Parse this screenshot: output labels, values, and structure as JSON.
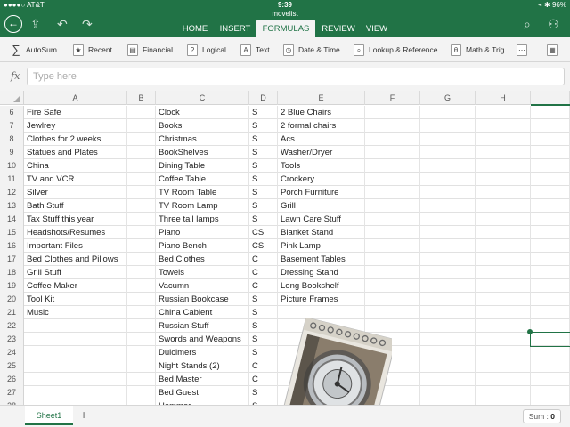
{
  "status_bar": {
    "left": "●●●●○ AT&T",
    "time": "9:39",
    "right": "⌁ ✱ 96%"
  },
  "document_title": "movelist",
  "ribbon_tabs": [
    {
      "label": "HOME",
      "active": false
    },
    {
      "label": "INSERT",
      "active": false
    },
    {
      "label": "FORMULAS",
      "active": true
    },
    {
      "label": "REVIEW",
      "active": false
    },
    {
      "label": "VIEW",
      "active": false
    }
  ],
  "toolbar": {
    "items": [
      {
        "label": "AutoSum",
        "icon": "sigma-icon"
      },
      {
        "label": "Recent",
        "icon": "star-icon"
      },
      {
        "label": "Financial",
        "icon": "financial-icon"
      },
      {
        "label": "Logical",
        "icon": "logical-icon"
      },
      {
        "label": "Text",
        "icon": "text-icon"
      },
      {
        "label": "Date & Time",
        "icon": "clock-icon"
      },
      {
        "label": "Lookup & Reference",
        "icon": "lookup-icon"
      },
      {
        "label": "Math & Trig",
        "icon": "math-icon"
      }
    ]
  },
  "formula_bar": {
    "fx_label": "fx",
    "placeholder": "Type here"
  },
  "columns": [
    "A",
    "B",
    "C",
    "D",
    "E",
    "F",
    "G",
    "H",
    "I"
  ],
  "rows": [
    {
      "n": "6",
      "A": "Fire Safe",
      "C": "Clock",
      "D": "S",
      "E": "2 Blue Chairs"
    },
    {
      "n": "7",
      "A": "Jewlrey",
      "C": "Books",
      "D": "S",
      "E": "2 formal chairs"
    },
    {
      "n": "8",
      "A": "Clothes for 2 weeks",
      "C": "Christmas",
      "D": "S",
      "E": "Acs"
    },
    {
      "n": "9",
      "A": "Statues and Plates",
      "C": "BookShelves",
      "D": "S",
      "E": "Washer/Dryer"
    },
    {
      "n": "10",
      "A": "China",
      "C": "Dining Table",
      "D": "S",
      "E": "Tools"
    },
    {
      "n": "11",
      "A": "TV and VCR",
      "C": "Coffee Table",
      "D": "S",
      "E": "Crockery"
    },
    {
      "n": "12",
      "A": "Silver",
      "C": "TV Room Table",
      "D": "S",
      "E": "Porch Furniture"
    },
    {
      "n": "13",
      "A": "Bath Stuff",
      "C": "TV Room Lamp",
      "D": "S",
      "E": "Grill"
    },
    {
      "n": "14",
      "A": "Tax Stuff this year",
      "C": "Three tall lamps",
      "D": "S",
      "E": "Lawn Care Stuff"
    },
    {
      "n": "15",
      "A": "Headshots/Resumes",
      "C": "Piano",
      "D": "CS",
      "E": "Blanket Stand"
    },
    {
      "n": "16",
      "A": "Important Files",
      "C": "Piano Bench",
      "D": "CS",
      "E": "Pink Lamp"
    },
    {
      "n": "17",
      "A": "Bed Clothes and Pillows",
      "C": "Bed Clothes",
      "D": "C",
      "E": "Basement Tables"
    },
    {
      "n": "18",
      "A": "Grill Stuff",
      "C": "Towels",
      "D": "C",
      "E": "Dressing Stand"
    },
    {
      "n": "19",
      "A": "Coffee Maker",
      "C": "Vacumn",
      "D": "C",
      "E": "Long Bookshelf"
    },
    {
      "n": "20",
      "A": "Tool Kit",
      "C": "Russian Bookcase",
      "D": "S",
      "E": "Picture Frames"
    },
    {
      "n": "21",
      "A": "Music",
      "C": "China Cabient",
      "D": "S",
      "E": ""
    },
    {
      "n": "22",
      "A": "",
      "C": "Russian Stuff",
      "D": "S",
      "E": ""
    },
    {
      "n": "23",
      "A": "",
      "C": "Swords and Weapons",
      "D": "S",
      "E": ""
    },
    {
      "n": "24",
      "A": "",
      "C": "Dulcimers",
      "D": "S",
      "E": ""
    },
    {
      "n": "25",
      "A": "",
      "C": "Night Stands (2)",
      "D": "C",
      "E": ""
    },
    {
      "n": "26",
      "A": "",
      "C": "Bed Master",
      "D": "C",
      "E": ""
    },
    {
      "n": "27",
      "A": "",
      "C": "Bed Guest",
      "D": "S",
      "E": ""
    },
    {
      "n": "28",
      "A": "",
      "C": "Hammer",
      "D": "S",
      "E": ""
    }
  ],
  "sheet_tabs": [
    {
      "label": "Sheet1",
      "active": true
    }
  ],
  "add_sheet_label": "+",
  "status_sum": {
    "label": "Sum :",
    "value": "0"
  },
  "colors": {
    "accent": "#217346"
  }
}
